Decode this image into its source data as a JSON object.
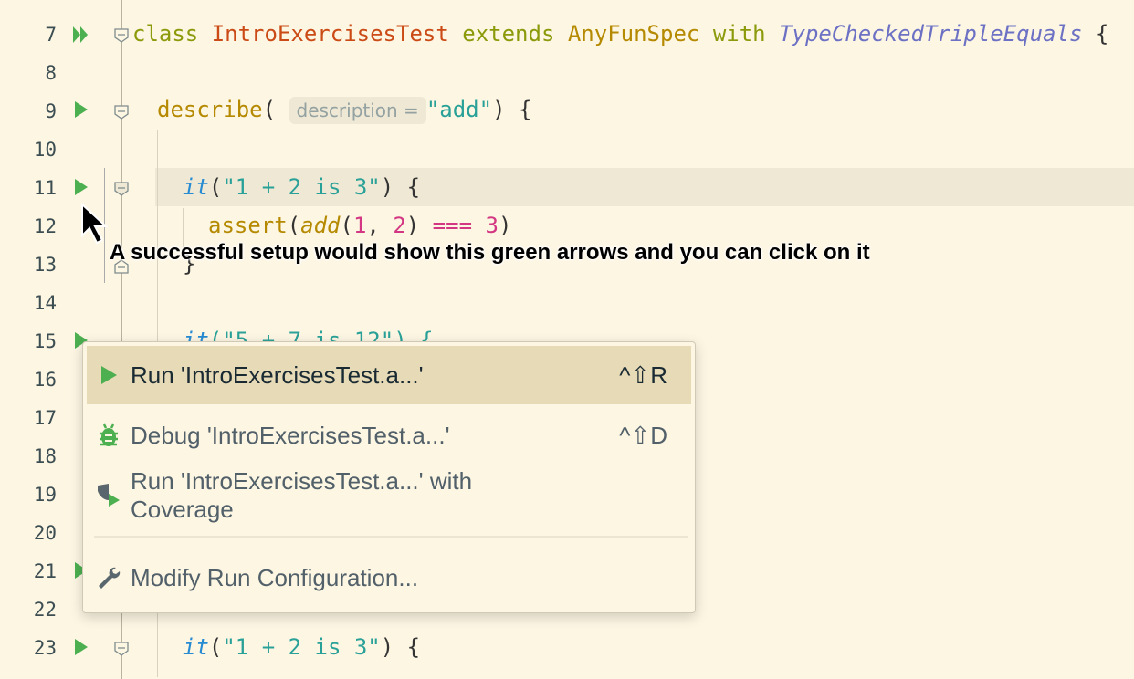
{
  "line_numbers": [
    "7",
    "8",
    "9",
    "10",
    "11",
    "12",
    "13",
    "14",
    "15",
    "16",
    "17",
    "18",
    "19",
    "20",
    "21",
    "22",
    "23"
  ],
  "code": {
    "l7": {
      "kw1": "class",
      "cls": "IntroExercisesTest",
      "kw2": "extends",
      "parent": "AnyFunSpec",
      "kw3": "with",
      "trait": "TypeCheckedTripleEquals",
      "brace": "{"
    },
    "l9": {
      "fn": "describe",
      "open": "(",
      "hint": "description =",
      "str": "\"add\"",
      "close": ") {"
    },
    "l11": {
      "it": "it",
      "open": "(",
      "str": "\"1 + 2 is 3\"",
      "close": ") {"
    },
    "l12": {
      "fn": "assert",
      "open": "(",
      "add": "add",
      "args_open": "(",
      "n1": "1",
      "comma": ", ",
      "n2": "2",
      "args_close": ")",
      "op": " === ",
      "n3": "3",
      "close": ")"
    },
    "l13": {
      "close": "}"
    },
    "l15": {
      "it": "it",
      "text": "(\"5 + 7 is 12\") {"
    },
    "l23": {
      "it": "it",
      "open": "(",
      "str": "\"1 + 2 is 3\"",
      "close": ") {"
    }
  },
  "annotation": "A successful setup would show this green arrows and you can click on it",
  "popup": {
    "items": [
      {
        "label": "Run 'IntroExercisesTest.a...'",
        "shortcut": "^⇧R",
        "icon": "run-icon"
      },
      {
        "label": "Debug 'IntroExercisesTest.a...'",
        "shortcut": "^⇧D",
        "icon": "debug-icon"
      },
      {
        "label": "Run 'IntroExercisesTest.a...' with Coverage",
        "shortcut": "",
        "icon": "coverage-icon"
      },
      {
        "label": "Modify Run Configuration...",
        "shortcut": "",
        "icon": "wrench-icon"
      }
    ]
  },
  "colors": {
    "background": "#fdf6e3",
    "run_green": "#4caf50",
    "selection": "#e7dab7"
  }
}
